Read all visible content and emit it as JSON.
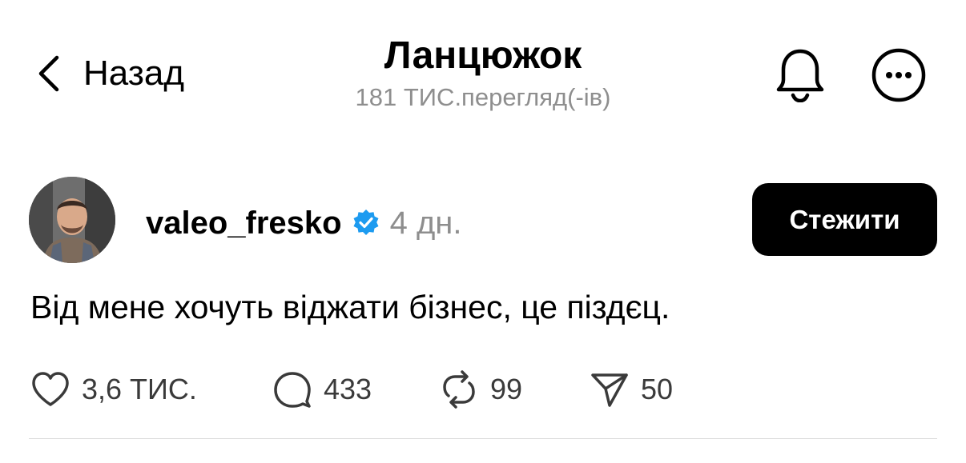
{
  "header": {
    "back_label": "Назад",
    "title": "Ланцюжок",
    "views": "181 ТИС.перегляд(-ів)",
    "icons": {
      "back": "chevron-left-icon",
      "notifications": "bell-icon",
      "more": "more-icon"
    }
  },
  "post": {
    "author": {
      "username": "valeo_fresko",
      "verified": true,
      "time": "4 дн."
    },
    "follow_label": "Стежити",
    "text": "Від мене хочуть віджати бізнес, це піздєц.",
    "actions": {
      "likes": "3,6 ТИС.",
      "comments": "433",
      "reposts": "99",
      "shares": "50"
    }
  },
  "colors": {
    "verified_badge": "#1d9bf0",
    "muted_text": "#8e8e8e",
    "follow_button_bg": "#000000"
  }
}
